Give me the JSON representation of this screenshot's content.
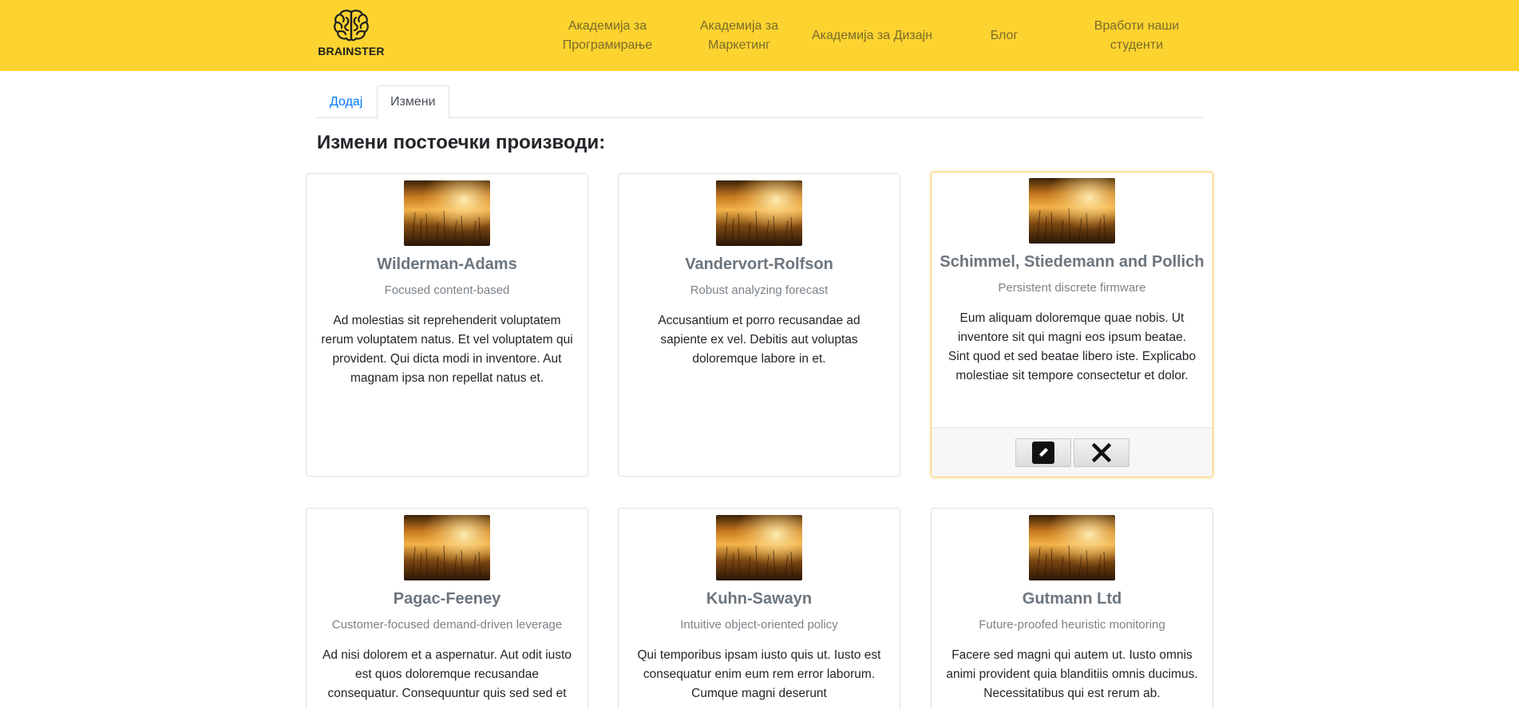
{
  "brand": {
    "name": "BRAINSTER",
    "accent": "#fdd330"
  },
  "nav": {
    "items": [
      {
        "label": "Академија за Програмирање"
      },
      {
        "label": "Академија за Маркетинг"
      },
      {
        "label": "Академија за Дизајн"
      },
      {
        "label": "Блог"
      },
      {
        "label": "Вработи наши студенти"
      }
    ]
  },
  "tabs": [
    {
      "label": "Додај",
      "active": false
    },
    {
      "label": "Измени",
      "active": true
    }
  ],
  "page_title": "Измени постоечки производи:",
  "products": [
    {
      "title": "Wilderman-Adams",
      "subtitle": "Focused content-based",
      "description": "Ad molestias sit reprehenderit voluptatem rerum voluptatem natus. Et vel voluptatem qui provident. Qui dicta modi in inventore. Aut magnam ipsa non repellat natus et.",
      "image_icon": "field-sunset-image"
    },
    {
      "title": "Vandervort-Rolfson",
      "subtitle": "Robust analyzing forecast",
      "description": "Accusantium et porro recusandae ad sapiente ex vel. Debitis aut voluptas doloremque labore in et.",
      "image_icon": "field-sunset-image"
    },
    {
      "title": "Schimmel, Stiedemann and Pollich",
      "subtitle": "Persistent discrete firmware",
      "description": "Eum aliquam doloremque quae nobis. Ut inventore sit qui magni eos ipsum beatae. Sint quod et sed beatae libero iste. Explicabo molestiae sit tempore consectetur et dolor.",
      "image_icon": "field-sunset-image",
      "actions": {
        "edit_icon": "pencil-icon",
        "delete_icon": "close-icon"
      }
    },
    {
      "title": "Pagac-Feeney",
      "subtitle": "Customer-focused demand-driven leverage",
      "description": "Ad nisi dolorem et a aspernatur. Aut odit iusto est quos doloremque recusandae consequatur. Consequuntur quis sed sed et",
      "image_icon": "field-sunset-image"
    },
    {
      "title": "Kuhn-Sawayn",
      "subtitle": "Intuitive object-oriented policy",
      "description": "Qui temporibus ipsam iusto quis ut. Iusto est consequatur enim eum rem error laborum. Cumque magni deserunt",
      "image_icon": "field-sunset-image"
    },
    {
      "title": "Gutmann Ltd",
      "subtitle": "Future-proofed heuristic monitoring",
      "description": "Facere sed magni qui autem ut. Iusto omnis animi provident quia blanditiis omnis ducimus. Necessitatibus qui est rerum ab.",
      "image_icon": "field-sunset-image"
    }
  ]
}
